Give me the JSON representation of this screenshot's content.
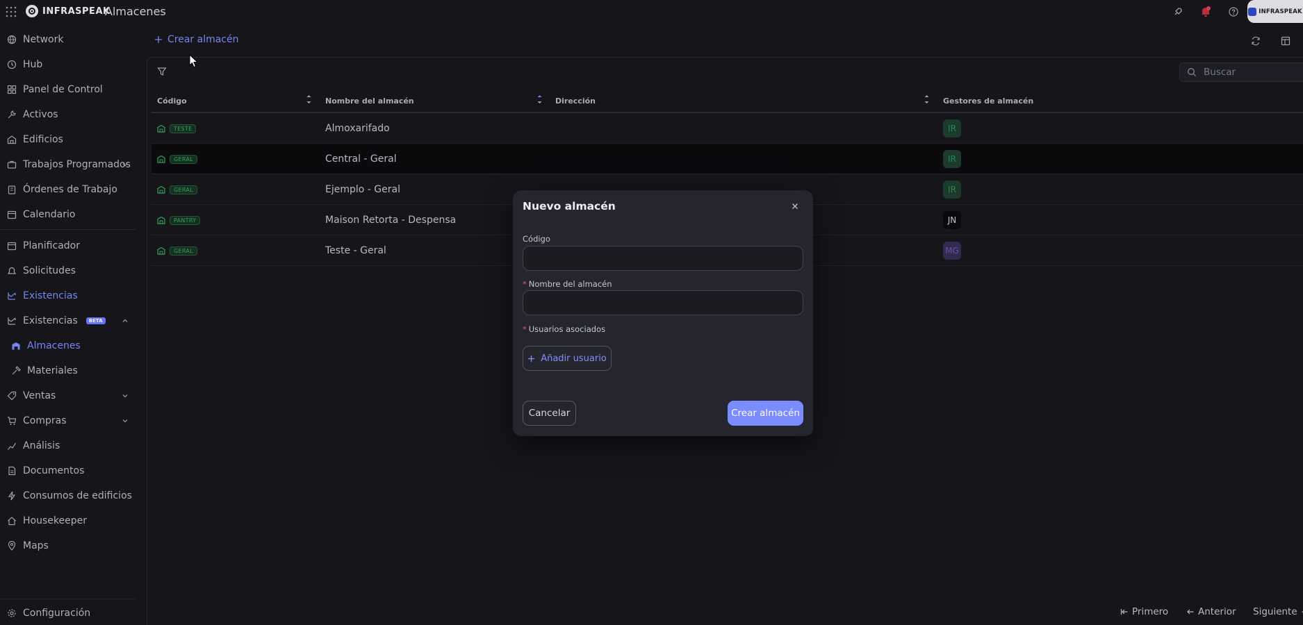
{
  "app": {
    "brand": "INFRASPEAK",
    "page_title": "Almacenes",
    "brand_chip": "INFRASPEAK"
  },
  "sidebar": {
    "items": [
      {
        "label": "Network",
        "icon": "globe-icon"
      },
      {
        "label": "Hub",
        "icon": "clock-icon"
      },
      {
        "label": "Panel de Control",
        "icon": "dashboard-icon"
      },
      {
        "label": "Activos",
        "icon": "wrench-icon"
      },
      {
        "label": "Edificios",
        "icon": "building-icon"
      },
      {
        "label": "Trabajos Programados",
        "icon": "briefcase-icon"
      },
      {
        "label": "Órdenes de Trabajo",
        "icon": "clipboard-icon"
      },
      {
        "label": "Calendario",
        "icon": "calendar-icon"
      },
      {
        "label": "Planificador",
        "icon": "calendar-icon"
      },
      {
        "label": "Solicitudes",
        "icon": "bell-icon"
      },
      {
        "label": "Existencias",
        "icon": "stock-icon"
      },
      {
        "label": "Existencias",
        "icon": "stock-icon",
        "badge": "BETA"
      },
      {
        "label": "Almacenes",
        "icon": "warehouse-icon"
      },
      {
        "label": "Materiales",
        "icon": "hammer-icon"
      },
      {
        "label": "Ventas",
        "icon": "tag-icon"
      },
      {
        "label": "Compras",
        "icon": "cart-icon"
      },
      {
        "label": "Análisis",
        "icon": "chart-icon"
      },
      {
        "label": "Documentos",
        "icon": "document-icon"
      },
      {
        "label": "Consumos de edificios",
        "icon": "bolt-icon"
      },
      {
        "label": "Housekeeper",
        "icon": "home-icon"
      },
      {
        "label": "Maps",
        "icon": "pin-icon"
      }
    ],
    "settings": "Configuración"
  },
  "toolbar": {
    "create_label": "Crear almacén",
    "search_placeholder": "Buscar"
  },
  "table": {
    "columns": [
      "Código",
      "Nombre del almacén",
      "Dirección",
      "Gestores de almacén"
    ],
    "rows": [
      {
        "code": "TESTE",
        "name": "Almoxarifado",
        "address": "",
        "manager": "IR",
        "manager_color": "#1e5b3c",
        "manager_text": "#2f8f5a"
      },
      {
        "code": "GERAL",
        "name": "Central - Geral",
        "address": "",
        "manager": "IR",
        "manager_color": "#1e5b3c",
        "manager_text": "#2f8f5a"
      },
      {
        "code": "GERAL",
        "name": "Ejemplo - Geral",
        "address": "",
        "manager": "IR",
        "manager_color": "#1e5b3c",
        "manager_text": "#2f8f5a"
      },
      {
        "code": "PANTRY",
        "name": "Maison Retorta - Despensa",
        "address": "",
        "manager": "JN",
        "manager_color": "#0b0b0e",
        "manager_text": "#d0d1d8"
      },
      {
        "code": "GERAL",
        "name": "Teste - Geral",
        "address": "",
        "manager": "MG",
        "manager_color": "#3a2f5e",
        "manager_text": "#6c5aa8"
      }
    ]
  },
  "modal": {
    "title": "Nuevo almacén",
    "code_label": "Código",
    "code_value": "",
    "name_label": "Nombre del almacén",
    "name_value": "",
    "users_label": "Usuarios asociados",
    "add_user": "Añadir usuario",
    "cancel": "Cancelar",
    "submit": "Crear almacén",
    "required_mark": "*"
  },
  "pager": {
    "first": "Primero",
    "prev": "Anterior",
    "next": "Siguiente"
  },
  "colors": {
    "accent": "#7b8cff",
    "background": "#17171c",
    "modal": "#24252d",
    "tag_green": "#3aa860"
  }
}
